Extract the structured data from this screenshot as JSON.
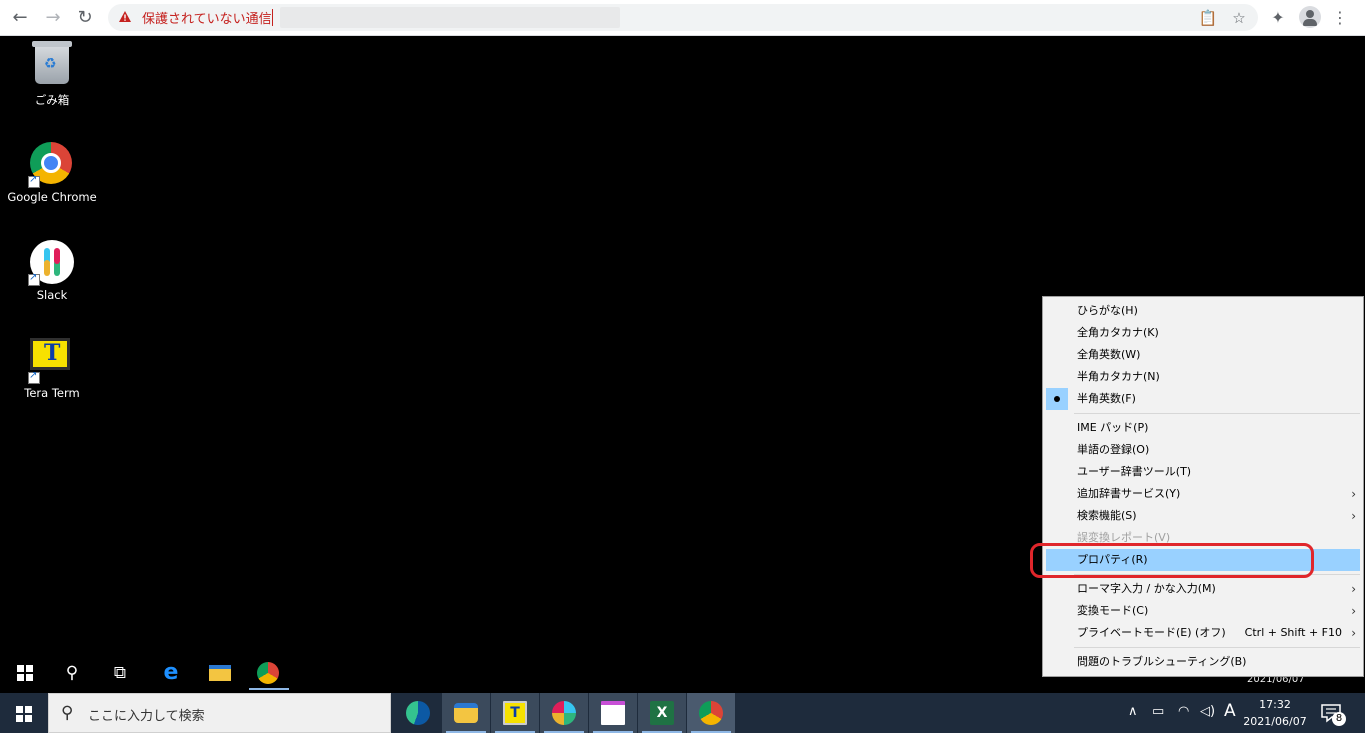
{
  "browser": {
    "security_label": "保護されていない通信"
  },
  "desktop": {
    "icons": [
      {
        "label": "ごみ箱"
      },
      {
        "label": "Google Chrome"
      },
      {
        "label": "Slack"
      },
      {
        "label": "Tera Term"
      }
    ]
  },
  "ime_menu": {
    "items": [
      {
        "label": "ひらがな(H)"
      },
      {
        "label": "全角カタカナ(K)"
      },
      {
        "label": "全角英数(W)"
      },
      {
        "label": "半角カタカナ(N)"
      },
      {
        "label": "半角英数(F)",
        "selected": true
      },
      {
        "label": "IME パッド(P)"
      },
      {
        "label": "単語の登録(O)"
      },
      {
        "label": "ユーザー辞書ツール(T)"
      },
      {
        "label": "追加辞書サービス(Y)",
        "submenu": true
      },
      {
        "label": "検索機能(S)",
        "submenu": true
      },
      {
        "label": "誤変換レポート(V)",
        "disabled": true
      },
      {
        "label": "プロパティ(R)",
        "highlighted": true
      },
      {
        "label": "ローマ字入力 / かな入力(M)",
        "submenu": true
      },
      {
        "label": "変換モード(C)",
        "submenu": true
      },
      {
        "label": "プライベートモード(E) (オフ)",
        "accelerator": "Ctrl + Shift + F10",
        "submenu": true
      },
      {
        "label": "問題のトラブルシューティング(B)"
      }
    ]
  },
  "remote_tray": {
    "date": "2021/06/07"
  },
  "taskbar": {
    "search_placeholder": "ここに入力して検索",
    "ime_indicator": "A",
    "time": "17:32",
    "date": "2021/06/07",
    "notification_count": "8"
  }
}
